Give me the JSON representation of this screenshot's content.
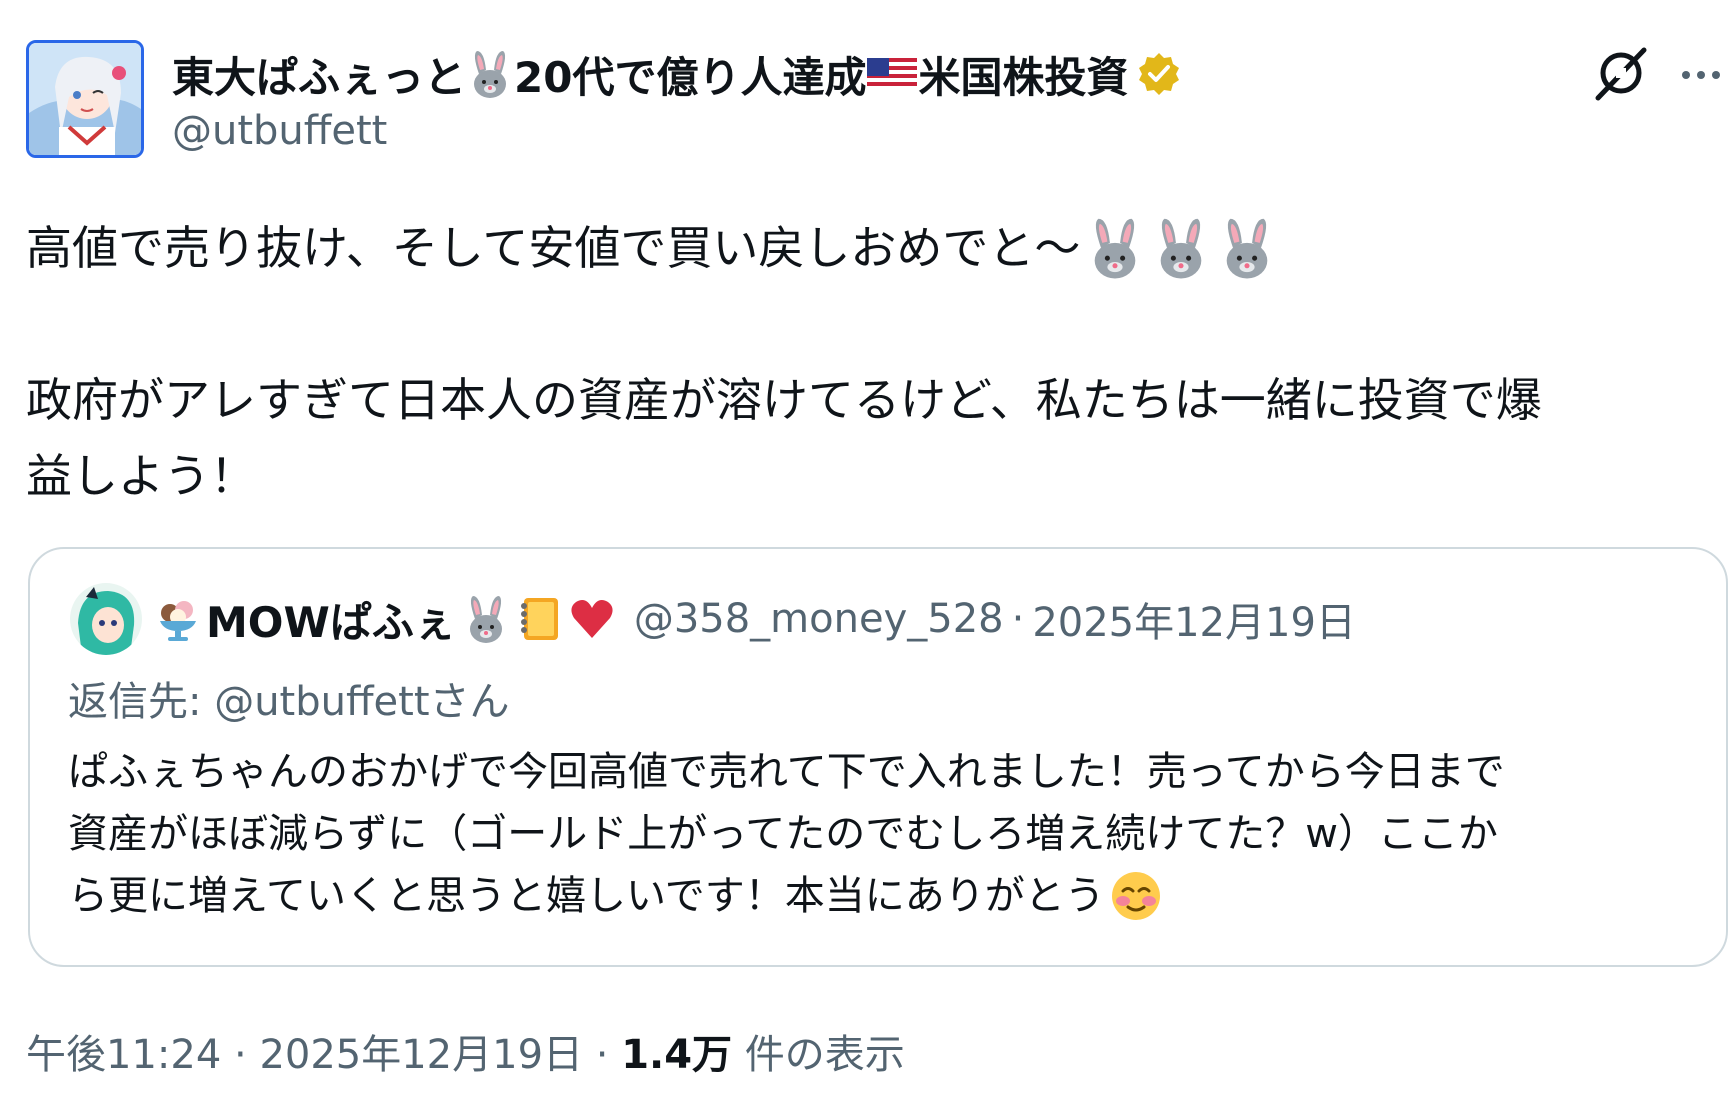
{
  "author": {
    "name_part1": "東大ぱふぇっと",
    "name_part2": "20代で億り人達成",
    "name_part3": "米国株投資",
    "handle": "@utbuffett",
    "verified": true
  },
  "header_icons": {
    "grok": "grok-icon",
    "more": "more-icon"
  },
  "tweet": {
    "line1": "高値で売り抜け、そして安値で買い戻しおめでと～",
    "line2": "政府がアレすぎて日本人の資産が溶けてるけど、私たちは一緒に投資で爆",
    "line3": "益しよう！"
  },
  "quote": {
    "name": "MOWぱふぇ",
    "handle": "@358_money_528",
    "separator": "·",
    "date": "2025年12月19日",
    "reply_label": "返信先:",
    "reply_handle": "@utbuffettさん",
    "line1": "ぱふぇちゃんのおかげで今回高値で売れて下で入れました！売ってから今日まで",
    "line2": "資産がほぼ減らずに（ゴールド上がってたのでむしろ増え続けてた？w）ここか",
    "line3": "ら更に増えていくと思うと嬉しいです！本当にありがとう"
  },
  "footer": {
    "time": "午後11:24",
    "sep1": "·",
    "date": "2025年12月19日",
    "sep2": "·",
    "views_count": "1.4万",
    "views_label": "件の表示"
  },
  "colors": {
    "text": "#0f1419",
    "secondary": "#536471",
    "border": "#cfd9de",
    "verified_gold": "#e2b719",
    "heart": "#dd2e44"
  }
}
